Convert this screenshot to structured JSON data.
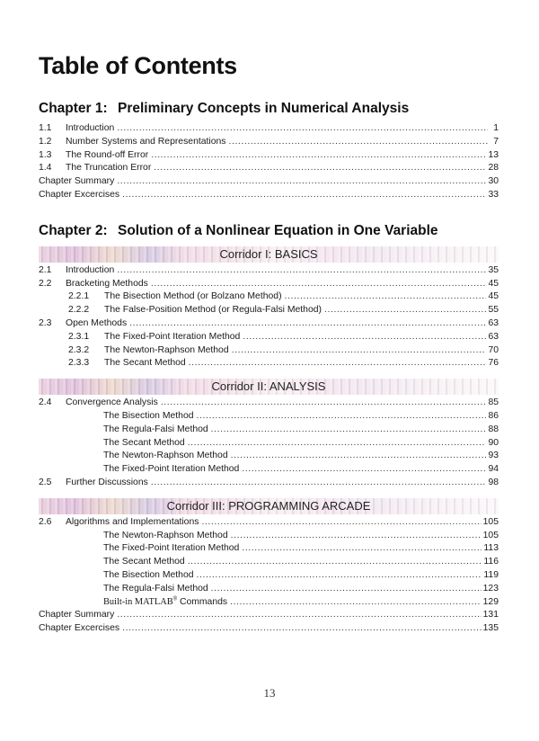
{
  "title": "Table of Contents",
  "chapters": [
    {
      "number": "Chapter 1:",
      "title": "Preliminary Concepts in Numerical Analysis",
      "entries": [
        {
          "num": "1.1",
          "label": "Introduction",
          "page": "1"
        },
        {
          "num": "1.2",
          "label": "Number Systems and Representations",
          "page": "7"
        },
        {
          "num": "1.3",
          "label": "The Round-off Error",
          "page": "13"
        },
        {
          "num": "1.4",
          "label": "The Truncation Error",
          "page": "28"
        },
        {
          "num": "",
          "label": "Chapter Summary",
          "page": "30"
        },
        {
          "num": "",
          "label": "Chapter Excercises",
          "page": "33"
        }
      ]
    },
    {
      "number": "Chapter 2:",
      "title": "Solution of a Nonlinear Equation in One Variable",
      "corridors": [
        {
          "label": "Corridor I: BASICS",
          "entries": [
            {
              "num": "2.1",
              "label": "Introduction",
              "page": "35"
            },
            {
              "num": "2.2",
              "label": "Bracketing Methods",
              "page": "45"
            },
            {
              "num": "2.2.1",
              "label": "The Bisection Method (or Bolzano Method)",
              "page": "45"
            },
            {
              "num": "2.2.2",
              "label": "The False-Position Method (or Regula-Falsi Method)",
              "page": "55"
            },
            {
              "num": "2.3",
              "label": "Open Methods",
              "page": "63"
            },
            {
              "num": "2.3.1",
              "label": "The Fixed-Point Iteration Method",
              "page": "63"
            },
            {
              "num": "2.3.2",
              "label": "The Newton-Raphson Method",
              "page": "70"
            },
            {
              "num": "2.3.3",
              "label": "The Secant Method",
              "page": "76"
            }
          ]
        },
        {
          "label": "Corridor II: ANALYSIS",
          "entries": [
            {
              "num": "2.4",
              "label": "Convergence Analysis",
              "page": "85"
            },
            {
              "num": "",
              "label": "The Bisection Method",
              "page": "86"
            },
            {
              "num": "",
              "label": "The Regula-Falsi Method",
              "page": "88"
            },
            {
              "num": "",
              "label": "The Secant Method",
              "page": "90"
            },
            {
              "num": "",
              "label": "The Newton-Raphson Method",
              "page": "93"
            },
            {
              "num": "",
              "label": "The Fixed-Point Iteration Method",
              "page": "94"
            },
            {
              "num": "2.5",
              "label": "Further Discussions",
              "page": "98"
            }
          ]
        },
        {
          "label": "Corridor III: PROGRAMMING ARCADE",
          "entries": [
            {
              "num": "2.6",
              "label": "Algorithms and Implementations",
              "page": "105"
            },
            {
              "num": "",
              "label": "The Newton-Raphson Method",
              "page": "105"
            },
            {
              "num": "",
              "label": "The Fixed-Point Iteration Method",
              "page": "113"
            },
            {
              "num": "",
              "label": "The Secant Method",
              "page": "116"
            },
            {
              "num": "",
              "label": "The Bisection Method",
              "page": "119"
            },
            {
              "num": "",
              "label": "The Regula-Falsi Method",
              "page": "123"
            },
            {
              "num": "",
              "label": "Built-in MATLAB",
              "label_sup": "®",
              "label_suffix": " Commands",
              "page": "129"
            },
            {
              "num": "",
              "label": "Chapter Summary",
              "page": "131"
            },
            {
              "num": "",
              "label": "Chapter Excercises",
              "page": "135"
            }
          ]
        }
      ]
    }
  ],
  "folio": "13"
}
